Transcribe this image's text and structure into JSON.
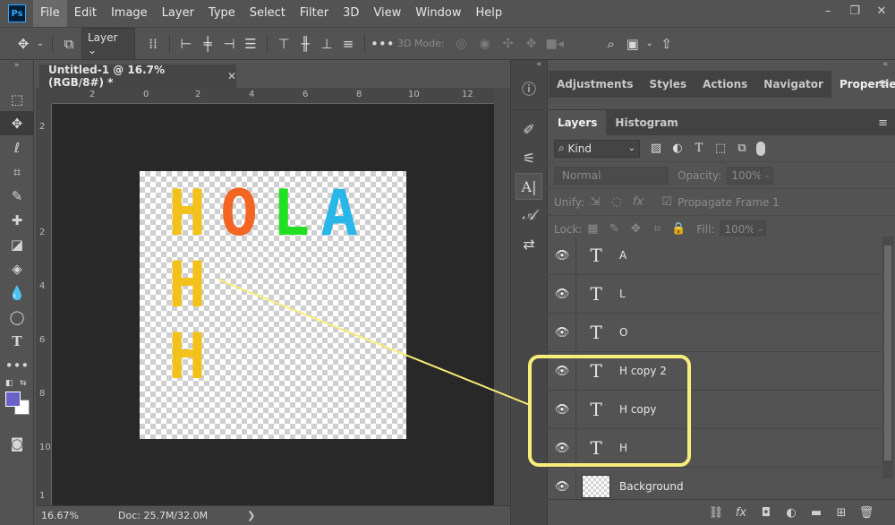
{
  "app": {
    "logo": "Ps"
  },
  "menu": [
    "File",
    "Edit",
    "Image",
    "Layer",
    "Type",
    "Select",
    "Filter",
    "3D",
    "View",
    "Window",
    "Help"
  ],
  "window_controls": {
    "minimize": "–",
    "restore": "❐",
    "close": "✕"
  },
  "options_bar": {
    "layer_select": "Layer",
    "mode_3d_label": "3D Mode:",
    "more": "•••"
  },
  "toolbar": {
    "collapse": "»",
    "icons": [
      "move-icon",
      "marquee-icon",
      "lasso-icon",
      "crop-icon",
      "brush-icon",
      "healing-icon",
      "eraser-icon",
      "bucket-icon",
      "blur-icon",
      "ellipse-icon",
      "type-icon",
      "more-tools-icon"
    ]
  },
  "colors": {
    "foreground": "#6a62c8",
    "background": "#ffffff"
  },
  "document": {
    "tab_title": "Untitled-1 @ 16.7% (RGB/8#) *",
    "close": "✕",
    "ruler_top_numbers": [
      "2",
      "0",
      "2",
      "4",
      "6",
      "8",
      "10",
      "12"
    ],
    "ruler_left_numbers": [
      "2",
      "2",
      "4",
      "6",
      "8",
      "10",
      "1"
    ],
    "canvas_letters": [
      {
        "char": "H",
        "color": "#f2c21b"
      },
      {
        "char": "O",
        "color": "#f26522"
      },
      {
        "char": "L",
        "color": "#22e021"
      },
      {
        "char": "A",
        "color": "#29b6e8"
      },
      {
        "char": "H",
        "color": "#f2c21b"
      },
      {
        "char": "H",
        "color": "#f2c21b"
      }
    ]
  },
  "status": {
    "zoom": "16.67%",
    "doc": "Doc: 25.7M/32.0M",
    "arrow": "❯"
  },
  "mini_panel": {
    "collapse": "«"
  },
  "panels": {
    "collapse": "«",
    "tabs_top": [
      "Adjustments",
      "Styles",
      "Actions",
      "Navigator",
      "Properties"
    ],
    "active_top": "Properties",
    "tabs_layers": [
      "Layers",
      "Histogram"
    ],
    "active_layers": "Layers",
    "menu": "≡"
  },
  "layers_panel": {
    "kind_label": "Kind",
    "blend_mode": "Normal",
    "opacity_label": "Opacity:",
    "opacity_value": "100%",
    "unify_label": "Unify:",
    "propagate_label": "Propagate Frame 1",
    "lock_label": "Lock:",
    "fill_label": "Fill:",
    "fill_value": "100%",
    "layers": [
      {
        "name": "A",
        "type": "text"
      },
      {
        "name": "L",
        "type": "text"
      },
      {
        "name": "O",
        "type": "text"
      },
      {
        "name": "H copy 2",
        "type": "text"
      },
      {
        "name": "H copy",
        "type": "text"
      },
      {
        "name": "H",
        "type": "text"
      },
      {
        "name": "Background",
        "type": "image"
      }
    ]
  },
  "annotation": {
    "color": "#f7ee7a"
  }
}
